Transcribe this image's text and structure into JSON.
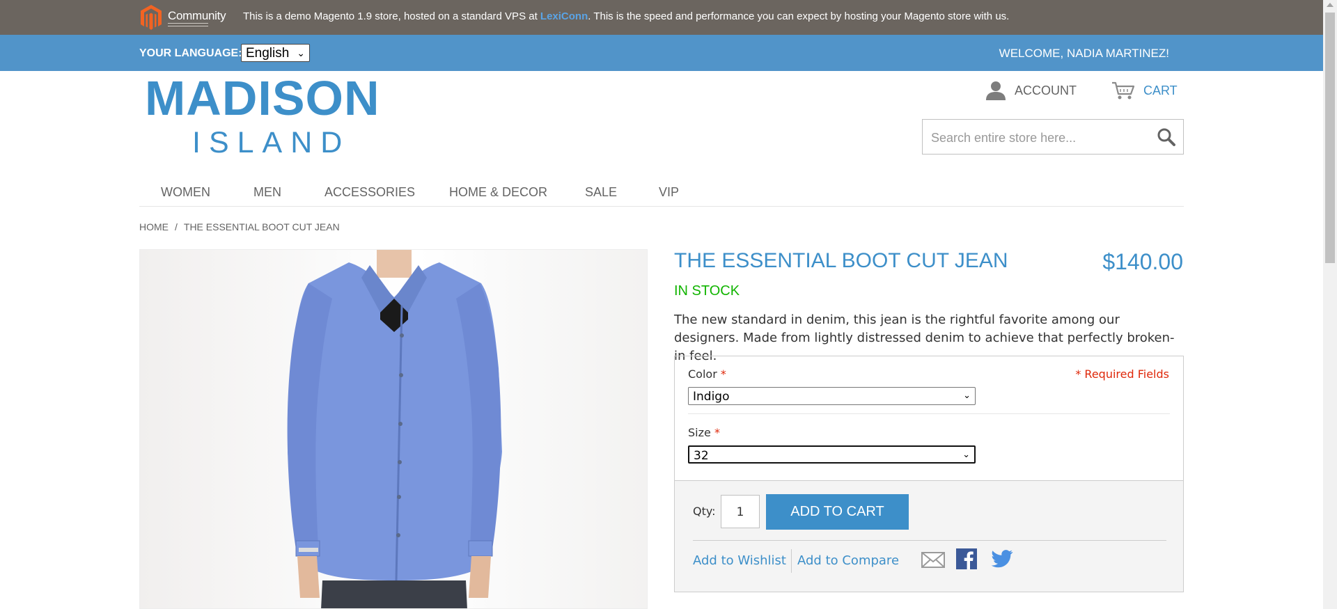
{
  "demo_bar": {
    "logo_text": "Community",
    "message_before": "This is a demo Magento 1.9 store, hosted on a standard VPS at ",
    "message_link": "LexiConn",
    "message_after": ". This is the speed and performance you can expect by hosting your Magento store with us."
  },
  "header": {
    "language_label": "YOUR LANGUAGE:",
    "language_value": "English",
    "welcome": "WELCOME, NADIA MARTINEZ!",
    "logo_line1": "MADISON",
    "logo_line2": "ISLAND",
    "account_label": "ACCOUNT",
    "cart_label": "CART",
    "search_placeholder": "Search entire store here..."
  },
  "nav": {
    "items": [
      "WOMEN",
      "MEN",
      "ACCESSORIES",
      "HOME & DECOR",
      "SALE",
      "VIP"
    ]
  },
  "breadcrumb": {
    "home": "HOME",
    "separator": "/",
    "current": "THE ESSENTIAL BOOT CUT JEAN"
  },
  "product": {
    "title": "THE ESSENTIAL BOOT CUT JEAN",
    "price": "$140.00",
    "stock": "IN STOCK",
    "description": "The new standard in denim, this jean is the rightful favorite among our designers. Made from lightly distressed denim to achieve that perfectly broken-in feel.",
    "required_note": "* Required Fields",
    "color_label": "Color",
    "color_value": "Indigo",
    "size_label": "Size",
    "size_value": "32",
    "required_mark": "*",
    "qty_label": "Qty:",
    "qty_value": "1",
    "add_to_cart": "ADD TO CART",
    "add_to_wishlist": "Add to Wishlist",
    "add_to_compare": "Add to Compare"
  },
  "colors": {
    "brand_blue": "#3d8fc9",
    "header_blue": "#5194c9",
    "demo_bar": "#6b655f",
    "in_stock": "#11b400",
    "required_red": "#df280a"
  },
  "icons": [
    "magento-logo-icon",
    "account-icon",
    "cart-icon",
    "search-icon",
    "email-icon",
    "facebook-icon",
    "twitter-icon"
  ]
}
